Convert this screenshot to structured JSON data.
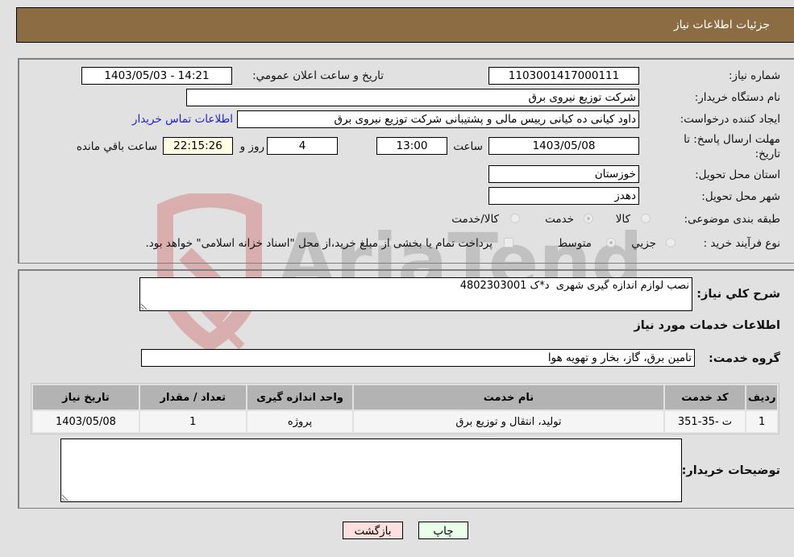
{
  "header": {
    "title": "جزئیات اطلاعات نیاز"
  },
  "form": {
    "need_number": {
      "label": "شماره نیاز:",
      "value": "1103001417000111"
    },
    "announce_datetime": {
      "label": "تاریخ و ساعت اعلان عمومي:",
      "value": "1403/05/03 - 14:21"
    },
    "buyer_org": {
      "label": "نام دستگاه خريدار:",
      "value": "شرکت توزیع نیروی برق"
    },
    "requester": {
      "label": "ايجاد کننده درخواست:",
      "value": "داود کیانی ده کیانی رییس مالی و پشتیبانی  شرکت توزیع نیروی برق",
      "contact_link": "اطلاعات تماس خريدار"
    },
    "deadline": {
      "label_line1": "مهلت ارسال پاسخ: تا",
      "label_line2": "تاريخ:",
      "date": "1403/05/08",
      "time_label": "ساعت",
      "time": "13:00",
      "days": "4",
      "days_label": "روز و",
      "remaining": "22:15:26",
      "remaining_label": "ساعت باقي مانده"
    },
    "province": {
      "label": "استان محل تحويل:",
      "value": "خوزستان"
    },
    "city": {
      "label": "شهر محل تحويل:",
      "value": "دهدز"
    },
    "category": {
      "label": "طبقه بندی موضوعی:",
      "options": [
        {
          "label": "کالا",
          "selected": false
        },
        {
          "label": "خدمت",
          "selected": true
        },
        {
          "label": "کالا/خدمت",
          "selected": false
        }
      ]
    },
    "purchase_type": {
      "label": "نوع فرآيند خريد :",
      "options": [
        {
          "label": "جزيي",
          "selected": false
        },
        {
          "label": "متوسط",
          "selected": true
        }
      ],
      "treasury_note": "پرداخت تمام یا بخشی از مبلغ خرید،از محل \"اسناد خزانه اسلامی\" خواهد بود.",
      "treasury_checked": false
    }
  },
  "details": {
    "description_label": "شرح کلي نياز:",
    "description_value": "نصب لوازم اندازه گیری شهری  د*ک 4802303001",
    "services_heading": "اطلاعات خدمات مورد نياز",
    "service_group_label": "گروه خدمت:",
    "service_group_value": "تامین برق، گاز، بخار و تهویه هوا",
    "table": {
      "headers": [
        "رديف",
        "کد خدمت",
        "نام خدمت",
        "واحد اندازه گيری",
        "تعداد / مقدار",
        "تاريخ نياز"
      ],
      "rows": [
        [
          "1",
          "ت -35-351",
          "تولید، انتقال و توزیع برق",
          "پروژه",
          "1",
          "1403/05/08"
        ]
      ]
    },
    "buyer_notes_label": "توضيحات خريدار:",
    "buyer_notes_value": ""
  },
  "buttons": {
    "print": "چاپ",
    "back": "بازگشت"
  },
  "colors": {
    "header_bg": "#8c6c43",
    "print_bg": "#eaffea",
    "back_bg": "#ffdede",
    "link": "#1c1cd6"
  }
}
